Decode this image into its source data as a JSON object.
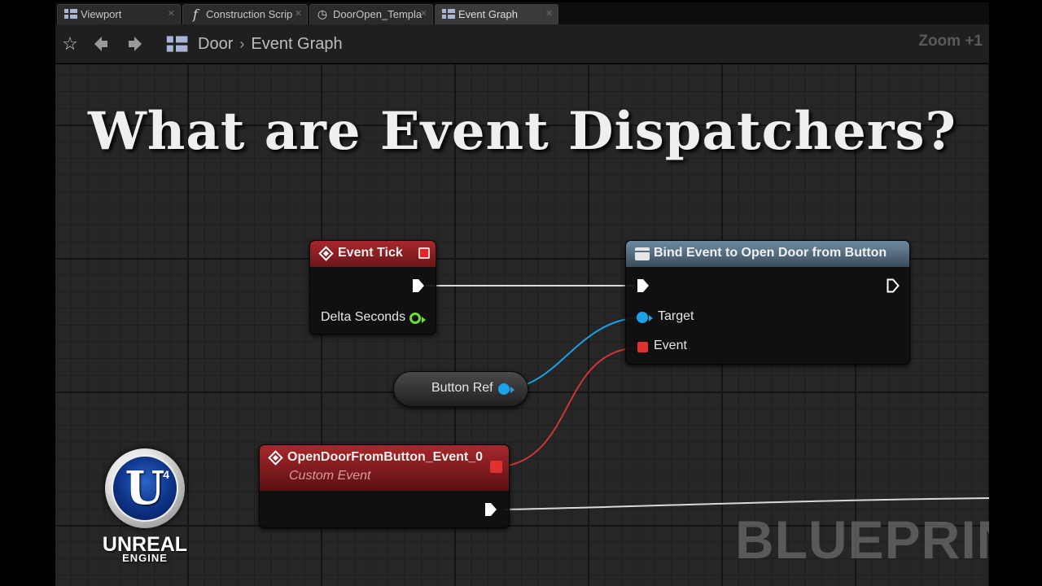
{
  "tabs": [
    {
      "label": "Viewport",
      "icon": "grid-icon"
    },
    {
      "label": "Construction Scrip",
      "icon": "function-icon"
    },
    {
      "label": "DoorOpen_Templa",
      "icon": "clock-icon"
    },
    {
      "label": "Event Graph",
      "icon": "grid-icon",
      "active": true
    }
  ],
  "toolbar": {
    "breadcrumb_root": "Door",
    "breadcrumb_current": "Event Graph",
    "zoom": "Zoom +1"
  },
  "overlay_title": "What are Event Dispatchers?",
  "nodes": {
    "event_tick": {
      "title": "Event Tick",
      "pin_delta": "Delta Seconds"
    },
    "bind_event": {
      "title": "Bind Event to Open Door from Button",
      "pin_target": "Target",
      "pin_event": "Event"
    },
    "button_ref": {
      "label": "Button Ref"
    },
    "custom_event": {
      "title": "OpenDoorFromButton_Event_0",
      "subtitle": "Custom Event"
    }
  },
  "colors": {
    "event_header": "#a8282c",
    "function_header": "#6e8aa0",
    "object_pin": "#1aa3e8",
    "float_pin": "#6ee02a",
    "delegate_pin": "#e03030"
  },
  "logo": {
    "line1": "UNREAL",
    "line2": "ENGINE",
    "badge": "4",
    "letter": "U"
  },
  "watermark": "BLUEPRINT"
}
